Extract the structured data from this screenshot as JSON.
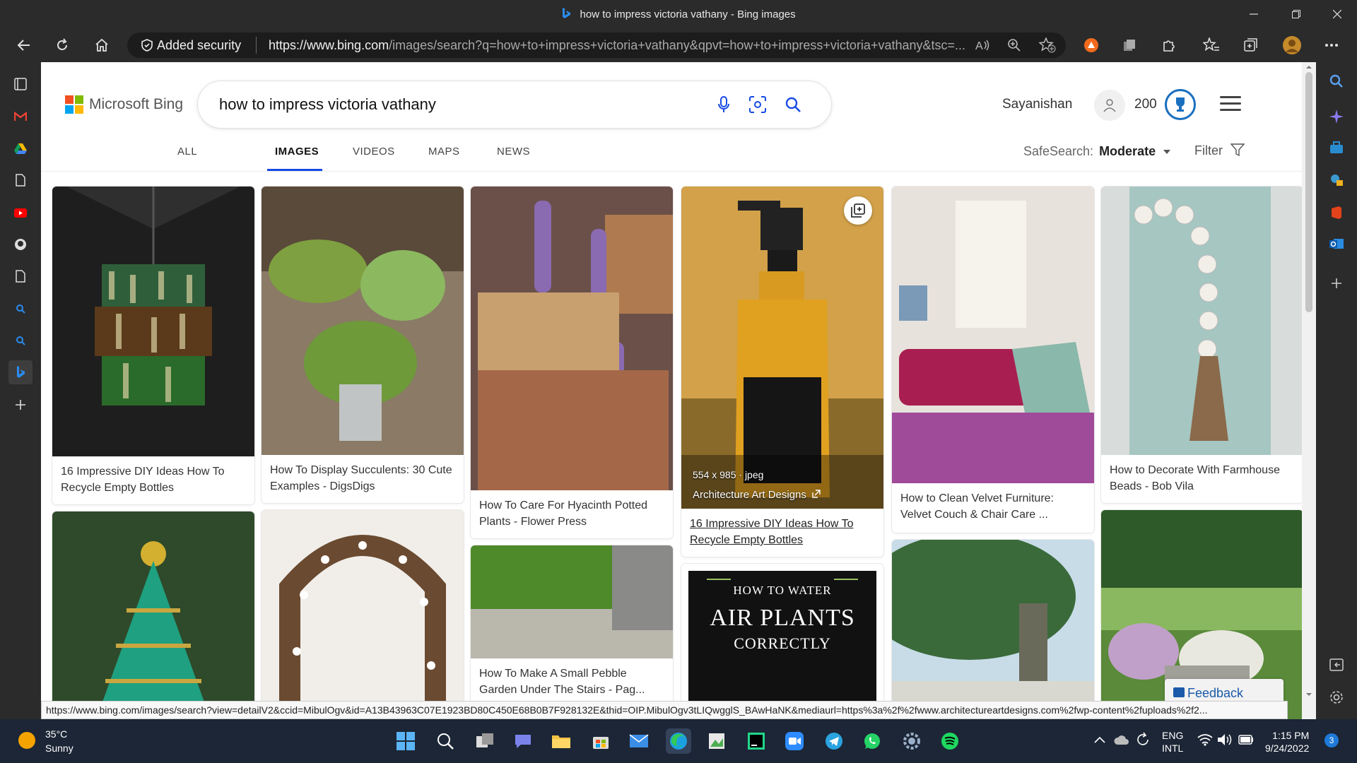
{
  "window": {
    "title": "how to impress victoria vathany - Bing images"
  },
  "toolbar": {
    "security": "Added security",
    "url_domain": "https://www.bing.com",
    "url_rest": "/images/search?q=how+to+impress+victoria+vathany&qpvt=how+to+impress+victoria+vathany&tsc=..."
  },
  "bing": {
    "brand": "Microsoft Bing",
    "query": "how to impress victoria vathany",
    "user": "Sayanishan",
    "points": "200",
    "tabs": [
      "ALL",
      "IMAGES",
      "VIDEOS",
      "MAPS",
      "NEWS"
    ],
    "active_tab": "IMAGES",
    "safesearch_label": "SafeSearch:",
    "safesearch_value": "Moderate",
    "filter": "Filter",
    "feedback": "Feedback"
  },
  "results": [
    {
      "caption": "16 Impressive DIY Ideas How To Recycle Empty Bottles"
    },
    {
      "caption": "How To Display Succulents: 30 Cute Examples - DigsDigs"
    },
    {
      "caption": "How To Care For Hyacinth Potted Plants - Flower Press"
    },
    {
      "caption": "16 Impressive DIY Ideas How To Recycle Empty Bottles",
      "dimensions": "554 x 985 · jpeg",
      "source": "Architecture Art Designs"
    },
    {
      "caption": "How to Clean Velvet Furniture: Velvet Couch & Chair Care ..."
    },
    {
      "caption": "How to Decorate With Farmhouse Beads - Bob Vila"
    },
    {
      "caption": ""
    },
    {
      "caption": ""
    },
    {
      "caption": "How To Make A Small Pebble Garden Under The Stairs - Pag..."
    },
    {
      "caption": "",
      "poster_line1": "HOW TO WATER",
      "poster_line2": "AIR PLANTS",
      "poster_line3": "CORRECTLY"
    },
    {
      "caption": ""
    },
    {
      "caption": ""
    }
  ],
  "status_url": "https://www.bing.com/images/search?view=detailV2&ccid=MibulOgv&id=A13B43963C07E1923BD80C450E68B0B7F928132E&thid=OIP.MibulOgv3tLIQwgglS_BAwHaNK&mediaurl=https%3a%2f%2fwww.architectureartdesigns.com%2fwp-content%2fuploads%2f2...",
  "taskbar": {
    "temp": "35°C",
    "weather": "Sunny",
    "lang1": "ENG",
    "lang2": "INTL",
    "time": "1:15 PM",
    "date": "9/24/2022",
    "notif_count": "3"
  },
  "colors": {
    "bing_blue": "#174ae4",
    "chrome_dark": "#2b2b2b",
    "taskbar": "#1c2636"
  }
}
